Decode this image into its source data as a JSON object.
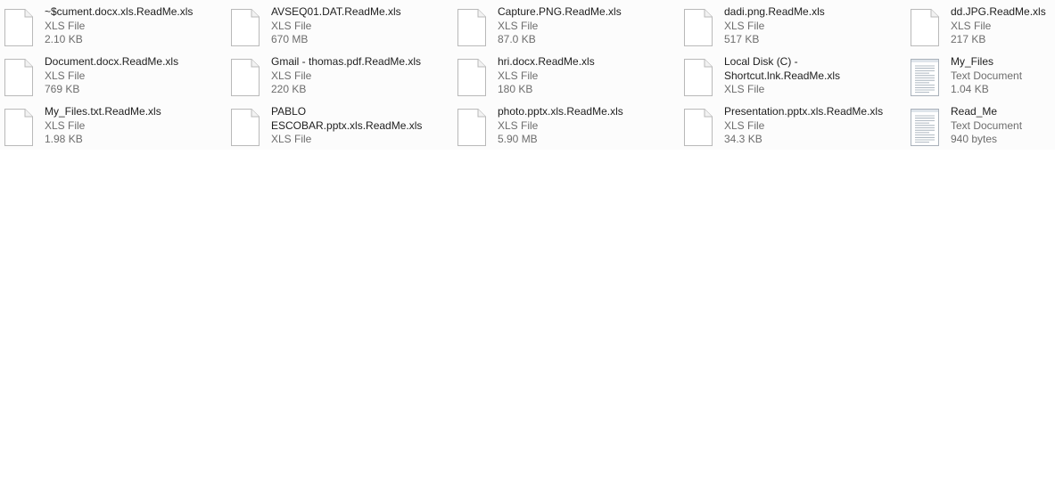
{
  "files": [
    {
      "name": "~$cument.docx.xls.ReadMe.xls",
      "type": "XLS File",
      "size": "2.10 KB",
      "icon": "blank-file-icon"
    },
    {
      "name": "AVSEQ01.DAT.ReadMe.xls",
      "type": "XLS File",
      "size": "670 MB",
      "icon": "blank-file-icon"
    },
    {
      "name": "Capture.PNG.ReadMe.xls",
      "type": "XLS File",
      "size": "87.0 KB",
      "icon": "blank-file-icon"
    },
    {
      "name": "dadi.png.ReadMe.xls",
      "type": "XLS File",
      "size": "517 KB",
      "icon": "blank-file-icon"
    },
    {
      "name": "dd.JPG.ReadMe.xls",
      "type": "XLS File",
      "size": "217 KB",
      "icon": "blank-file-icon"
    },
    {
      "name": "Document.docx.ReadMe.xls",
      "type": "XLS File",
      "size": "769 KB",
      "icon": "blank-file-icon"
    },
    {
      "name": "Gmail - thomas.pdf.ReadMe.xls",
      "type": "XLS File",
      "size": "220 KB",
      "icon": "blank-file-icon"
    },
    {
      "name": "hri.docx.ReadMe.xls",
      "type": "XLS File",
      "size": "180 KB",
      "icon": "blank-file-icon"
    },
    {
      "name": "Local Disk (C) -\nShortcut.lnk.ReadMe.xls",
      "type": "XLS File",
      "size": "",
      "icon": "blank-file-icon"
    },
    {
      "name": "My_Files",
      "type": "Text Document",
      "size": "1.04 KB",
      "icon": "text-document-icon"
    },
    {
      "name": "My_Files.txt.ReadMe.xls",
      "type": "XLS File",
      "size": "1.98 KB",
      "icon": "blank-file-icon"
    },
    {
      "name": "PABLO\nESCOBAR.pptx.xls.ReadMe.xls",
      "type": "XLS File",
      "size": "",
      "icon": "blank-file-icon"
    },
    {
      "name": "photo.pptx.xls.ReadMe.xls",
      "type": "XLS File",
      "size": "5.90 MB",
      "icon": "blank-file-icon"
    },
    {
      "name": "Presentation.pptx.xls.ReadMe.xls",
      "type": "XLS File",
      "size": "34.3 KB",
      "icon": "blank-file-icon"
    },
    {
      "name": "Read_Me",
      "type": "Text Document",
      "size": "940 bytes",
      "icon": "text-document-icon"
    }
  ]
}
